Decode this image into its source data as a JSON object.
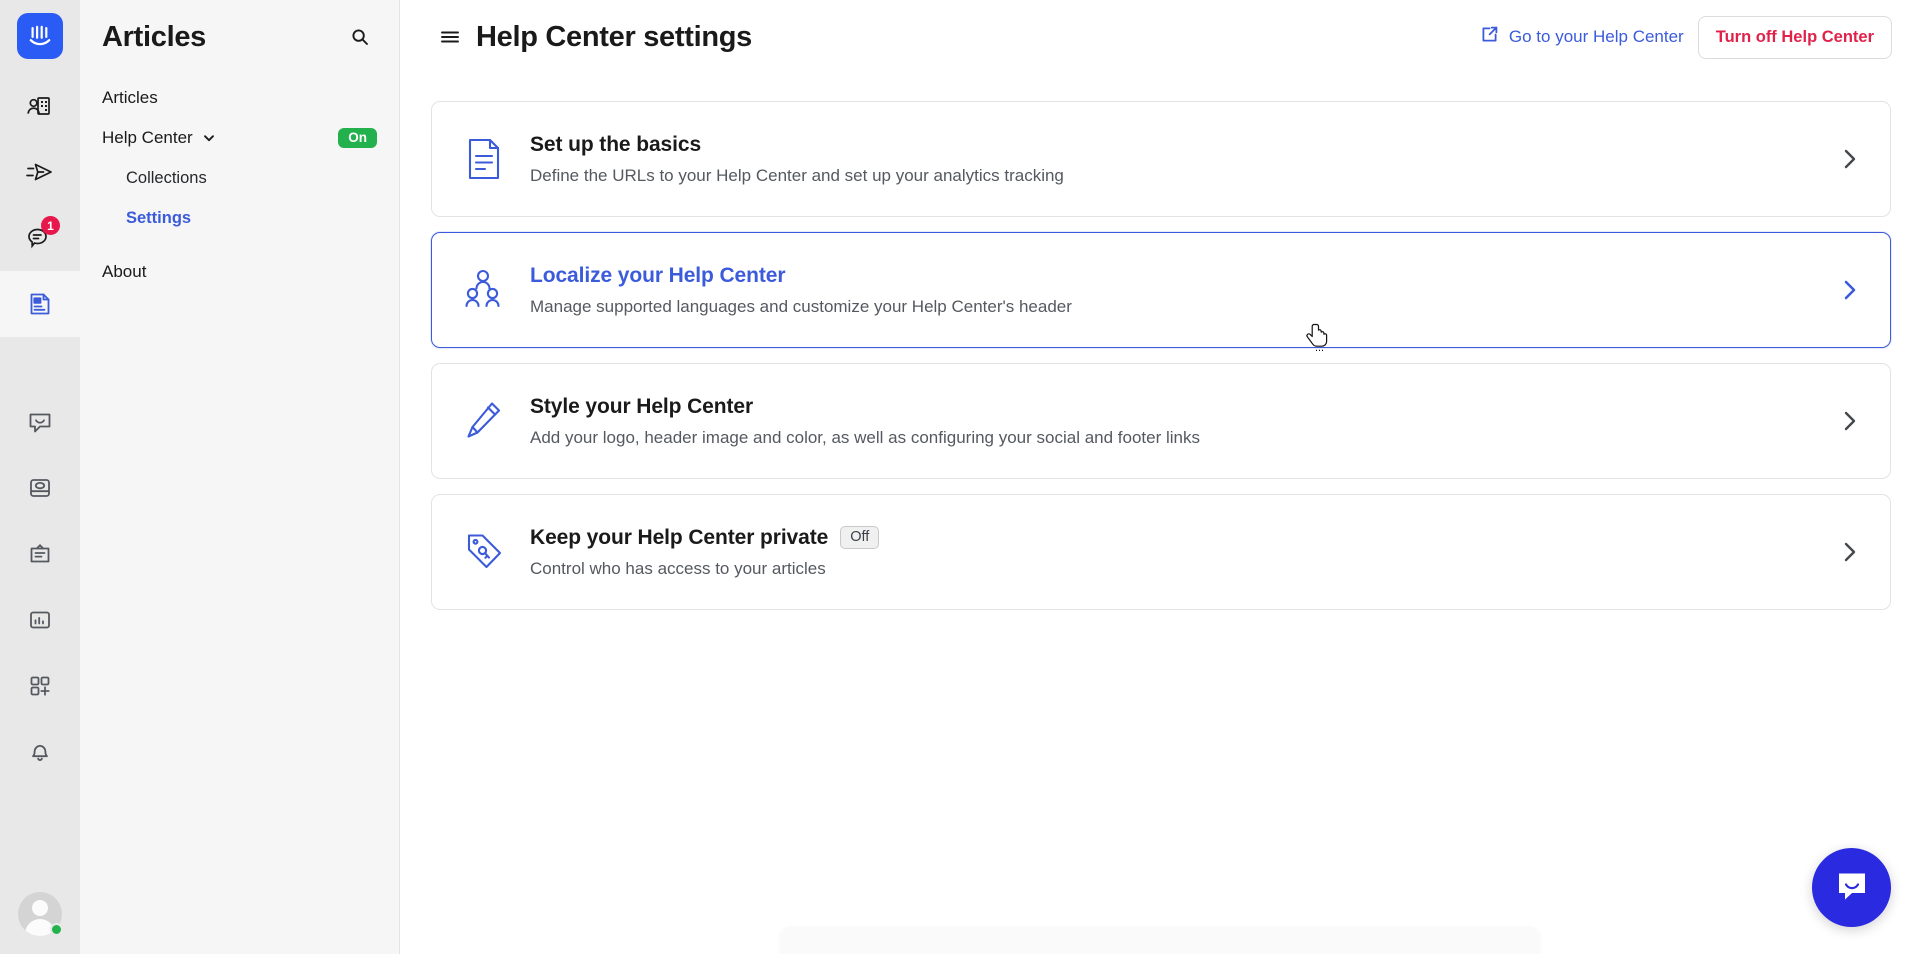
{
  "rail": {
    "logo_icon": "intercom-logo-icon",
    "items": [
      {
        "name": "contacts",
        "icon": "contacts-icon",
        "badge": null,
        "active": false
      },
      {
        "name": "outbound",
        "icon": "paper-plane-icon",
        "badge": null,
        "active": false
      },
      {
        "name": "inbox-conversations",
        "icon": "speech-bubble-icon",
        "badge": "1",
        "active": false
      },
      {
        "name": "articles",
        "icon": "article-document-icon",
        "badge": null,
        "active": true
      },
      {
        "name": "messenger",
        "icon": "messenger-bubble-icon",
        "badge": null,
        "active": false
      },
      {
        "name": "knowledge",
        "icon": "cards-stack-icon",
        "badge": null,
        "active": false
      },
      {
        "name": "surveys",
        "icon": "clipboard-icon",
        "badge": null,
        "active": false
      },
      {
        "name": "reports",
        "icon": "bar-chart-icon",
        "badge": null,
        "active": false
      },
      {
        "name": "apps",
        "icon": "apps-grid-plus-icon",
        "badge": null,
        "active": false
      },
      {
        "name": "notifications",
        "icon": "bell-icon",
        "badge": null,
        "active": false
      }
    ],
    "avatar": {
      "icon": "avatar",
      "presence": "online",
      "presence_color": "#23b14c"
    }
  },
  "sidebar": {
    "title": "Articles",
    "search_icon": "search-icon",
    "items": [
      {
        "label": "Articles",
        "level": 0,
        "selected": false,
        "caret": false,
        "pill": null
      },
      {
        "label": "Help Center",
        "level": 0,
        "selected": false,
        "caret": true,
        "pill": "On"
      },
      {
        "label": "Collections",
        "level": 1,
        "selected": false,
        "caret": false,
        "pill": null
      },
      {
        "label": "Settings",
        "level": 1,
        "selected": true,
        "caret": false,
        "pill": null
      },
      {
        "label": "About",
        "level": 0,
        "selected": false,
        "caret": false,
        "pill": null
      }
    ]
  },
  "header": {
    "menu_icon": "hamburger-menu-icon",
    "title": "Help Center settings",
    "external_link_icon": "external-link-icon",
    "external_link_label": "Go to your Help Center",
    "turn_off_label": "Turn off Help Center",
    "turn_off_color": "#e0224b",
    "link_color": "#3b5bdb"
  },
  "cards": [
    {
      "icon": "document-lines-icon",
      "title": "Set up the basics",
      "subtitle": "Define the URLs to your Help Center and set up your analytics tracking",
      "state_chip": null,
      "highlighted": false,
      "chevron_icon": "chevron-right-icon"
    },
    {
      "icon": "people-group-icon",
      "title": "Localize your Help Center",
      "subtitle": "Manage supported languages and customize your Help Center's header",
      "state_chip": null,
      "highlighted": true,
      "chevron_icon": "chevron-right-icon"
    },
    {
      "icon": "pencil-icon",
      "title": "Style your Help Center",
      "subtitle": "Add your logo, header image and color, as well as configuring your social and footer links",
      "state_chip": null,
      "highlighted": false,
      "chevron_icon": "chevron-right-icon"
    },
    {
      "icon": "tag-lock-icon",
      "title": "Keep your Help Center private",
      "subtitle": "Control who has access to your articles",
      "state_chip": "Off",
      "highlighted": false,
      "chevron_icon": "chevron-right-icon"
    }
  ],
  "launcher": {
    "icon": "messenger-launcher-icon",
    "color": "#2a2ae0"
  },
  "cursor": {
    "icon": "pointing-hand-cursor"
  },
  "colors": {
    "accent": "#3b5bdb",
    "danger": "#e0224b",
    "success": "#22b14c",
    "rail_bg": "#e8e8e8",
    "sidebar_bg": "#f6f6f6"
  }
}
